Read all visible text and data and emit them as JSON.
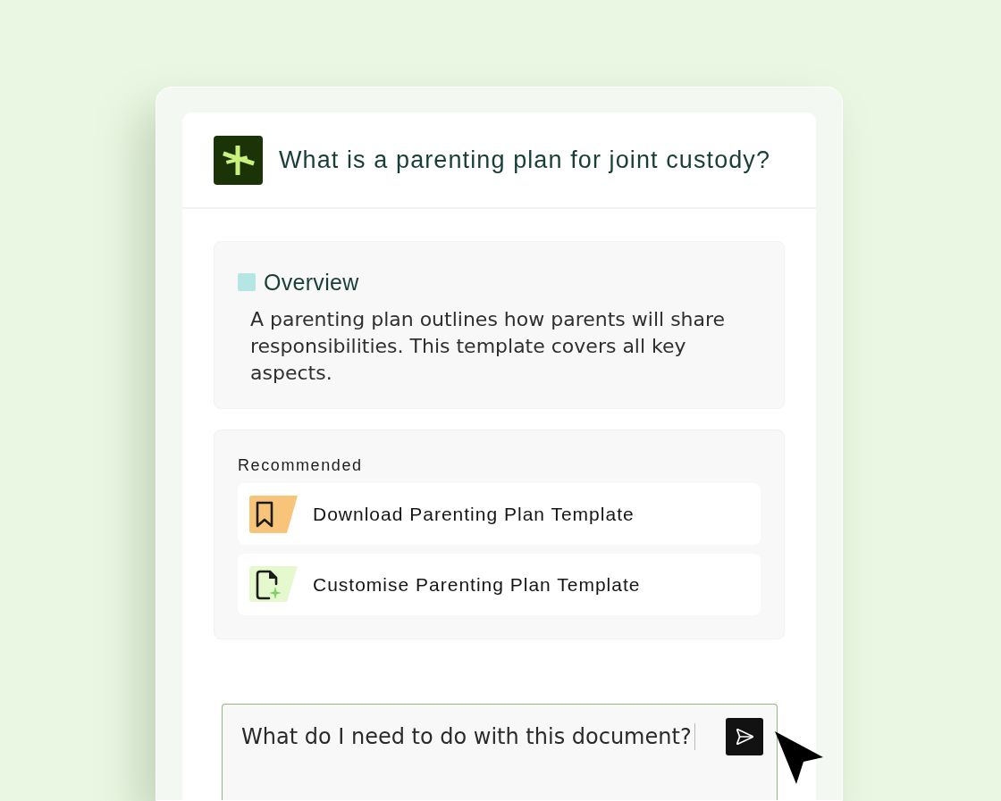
{
  "chat": {
    "question": "What is a parenting plan for joint custody?"
  },
  "overview": {
    "heading": "Overview",
    "text": "A parenting plan outlines how parents will share responsibilities. This template covers all key aspects."
  },
  "recommended": {
    "heading": "Recommended",
    "items": [
      {
        "kind": "bookmark",
        "label": "Download Parenting Plan Template"
      },
      {
        "kind": "document",
        "label": "Customise Parenting Plan Template"
      }
    ]
  },
  "composer": {
    "value": "What do I need to do with this document?"
  }
}
